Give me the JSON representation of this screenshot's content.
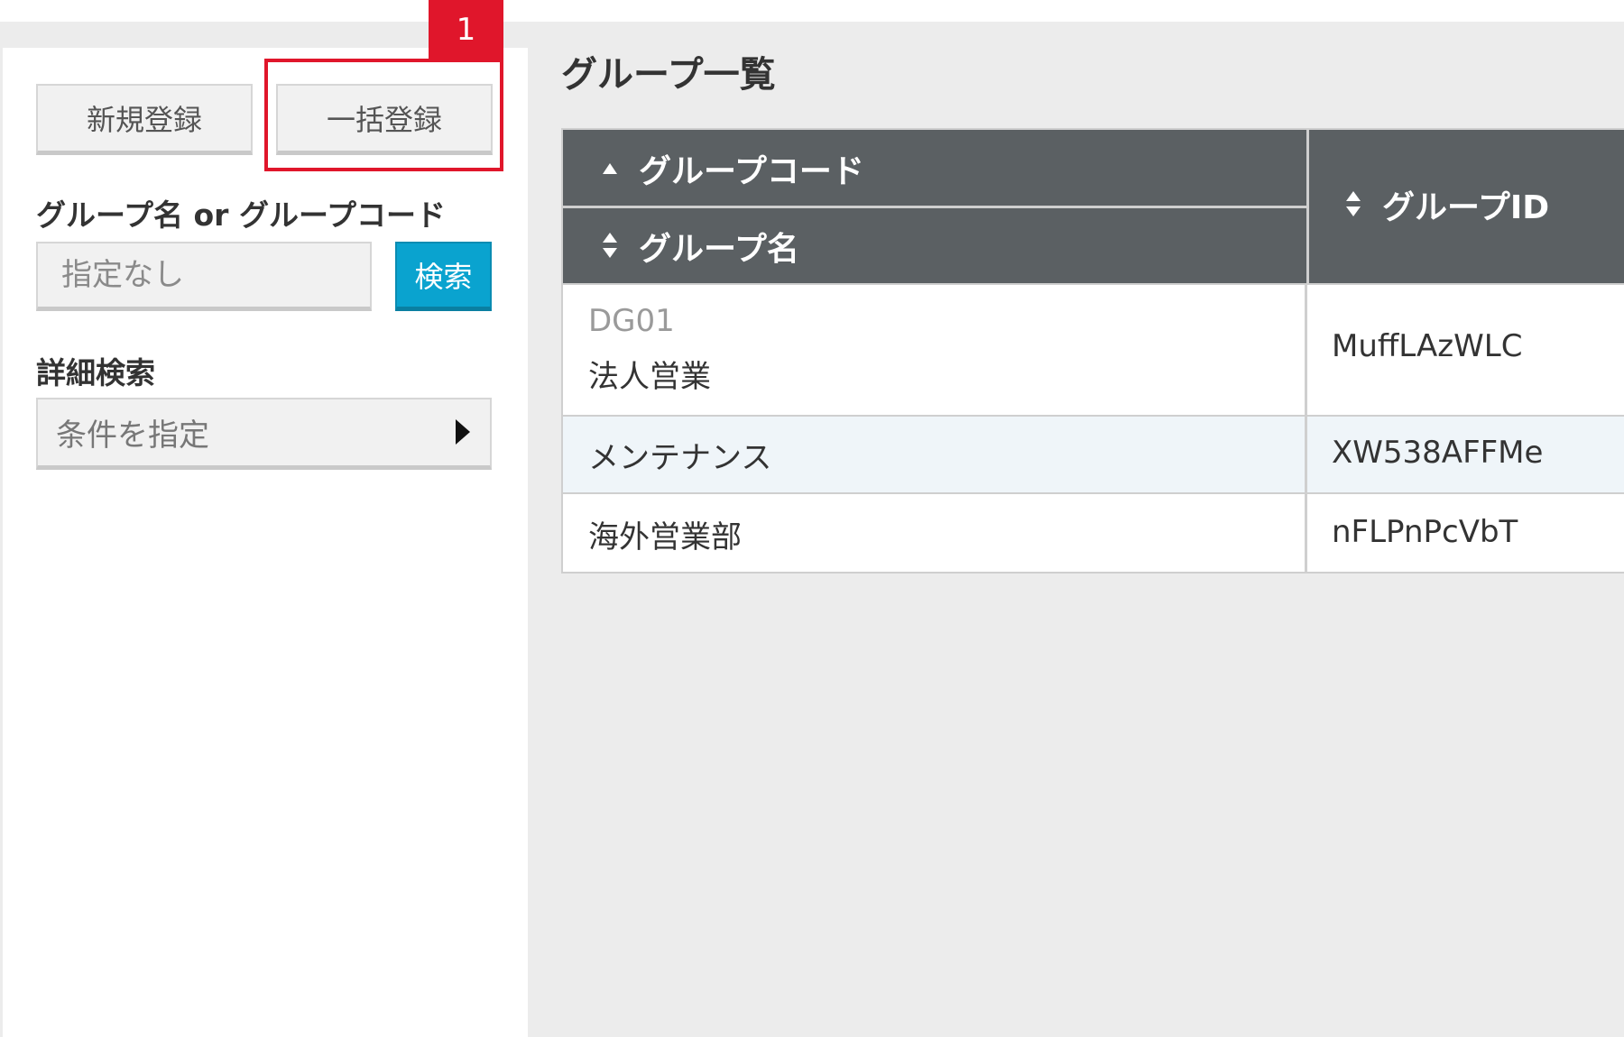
{
  "sidebar": {
    "new_button_label": "新規登録",
    "bulk_button_label": "一括登録",
    "search_label": "グループ名 or グループコード",
    "search_placeholder": "指定なし",
    "search_button_label": "検索",
    "detail_label": "詳細検索",
    "detail_select_value": "条件を指定"
  },
  "annotation": {
    "badge_number": "1"
  },
  "main": {
    "title": "グループ一覧",
    "table": {
      "headers": {
        "code": "グループコード",
        "name": "グループ名",
        "id": "グループID"
      },
      "rows": [
        {
          "code": "DG01",
          "name": "法人営業",
          "id": "MuffLAzWLC"
        },
        {
          "code": "",
          "name": "メンテナンス",
          "id": "XW538AFFMe"
        },
        {
          "code": "",
          "name": "海外営業部",
          "id": "nFLPnPcVbT"
        }
      ]
    }
  },
  "colors": {
    "highlight": "#e0162b",
    "search_button": "#0aa3cf",
    "table_header": "#5b6063",
    "row_alt": "#eff5f9"
  },
  "icons": {
    "sort_ascending": "sort-ascending-icon",
    "sort_both": "sort-icon",
    "caret_right": "caret-right-icon"
  }
}
